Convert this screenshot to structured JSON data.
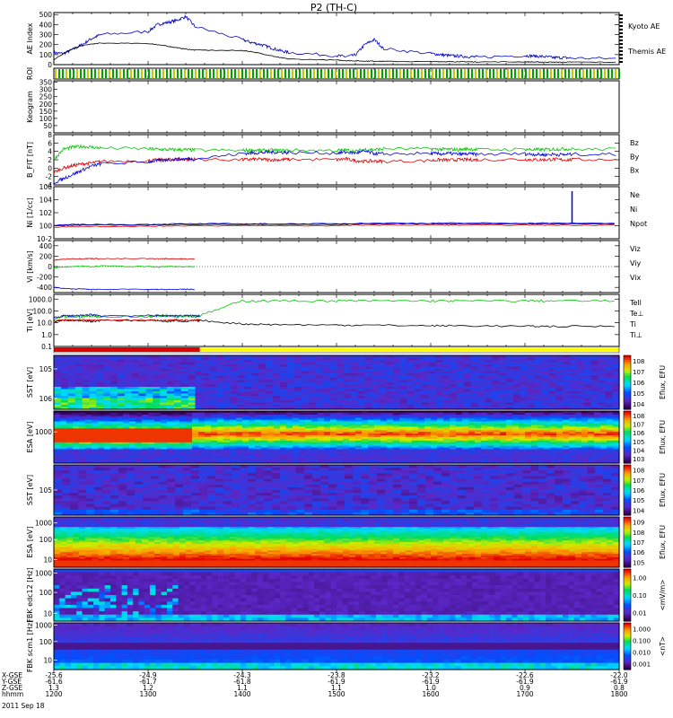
{
  "title": "P2 (TH-C)",
  "chart_data": [
    {
      "type": "line",
      "ylabel": "AE Index",
      "yticks": [
        "0",
        "100",
        "200",
        "300",
        "400",
        "500"
      ],
      "ylim": [
        0,
        520
      ],
      "x": [
        1200,
        1210,
        1220,
        1230,
        1240,
        1250,
        1300,
        1310,
        1320,
        1330,
        1340,
        1350,
        1400,
        1410,
        1420,
        1430,
        1440,
        1450,
        1500,
        1510,
        1520,
        1530,
        1540,
        1550,
        1600,
        1610,
        1620,
        1630,
        1640,
        1650,
        1700,
        1710,
        1720,
        1730,
        1740,
        1750,
        1800
      ],
      "series": [
        {
          "name": "Kyoto AE",
          "color": "#0000c8",
          "values": [
            120,
            110,
            150,
            200,
            260,
            300,
            330,
            400,
            420,
            440,
            480,
            380,
            250,
            220,
            200,
            170,
            140,
            120,
            90,
            80,
            95,
            200,
            250,
            160,
            110,
            100,
            90,
            85,
            80,
            75,
            90,
            85,
            80,
            70,
            70,
            65,
            60
          ]
        },
        {
          "name": "Themis AE",
          "color": "#000000",
          "values": [
            50,
            110,
            160,
            190,
            205,
            215,
            210,
            200,
            185,
            170,
            155,
            145,
            140,
            130,
            110,
            90,
            70,
            55,
            45,
            40,
            38,
            35,
            35,
            32,
            30,
            30,
            28,
            30,
            28,
            27,
            28,
            26,
            25,
            25,
            24,
            25,
            24
          ]
        }
      ]
    },
    {
      "type": "table",
      "ylabel": "ROI"
    },
    {
      "type": "table",
      "ylabel": "Keogram",
      "yticks": [
        "50",
        "100",
        "150",
        "200",
        "250",
        "300",
        "350"
      ]
    },
    {
      "type": "line",
      "ylabel": "B_FIT [nT]",
      "yticks": [
        "-4",
        "-2",
        "0",
        "2",
        "4",
        "6",
        "8"
      ],
      "ylim": [
        -4,
        8
      ],
      "x": [
        1200,
        1210,
        1220,
        1230,
        1240,
        1250,
        1300,
        1310,
        1320,
        1330,
        1340,
        1350,
        1400,
        1410,
        1420,
        1430,
        1440,
        1450,
        1500,
        1510,
        1520,
        1530,
        1540,
        1550,
        1600,
        1610,
        1620,
        1630,
        1640,
        1650,
        1700,
        1710,
        1720,
        1730,
        1740,
        1750,
        1800
      ],
      "series": [
        {
          "name": "Bz",
          "color": "#e00000",
          "values": [
            -1.0,
            0.0,
            0.6,
            1.0,
            1.2,
            1.6,
            1.8,
            1.9,
            2.0,
            2.1,
            2.1,
            2.1,
            2.0,
            2.1,
            2.1,
            2.0,
            2.0,
            2.1,
            2.0,
            2.2,
            1.8,
            1.6,
            1.7,
            1.6,
            1.8,
            2.0,
            1.9,
            2.0,
            2.0,
            2.0,
            2.1,
            2.0,
            2.0,
            2.1,
            2.0,
            2.0,
            2.1
          ]
        },
        {
          "name": "By",
          "color": "#00c800",
          "values": [
            2.0,
            4.5,
            5.0,
            5.2,
            5.0,
            4.8,
            4.6,
            4.5,
            4.4,
            4.4,
            4.4,
            4.3,
            4.2,
            4.3,
            4.2,
            4.3,
            4.2,
            4.3,
            4.2,
            4.3,
            4.0,
            4.5,
            4.4,
            4.6,
            4.6,
            4.5,
            4.5,
            4.4,
            4.6,
            4.4,
            4.5,
            4.4,
            4.4,
            4.5,
            4.6,
            4.5,
            4.5
          ]
        },
        {
          "name": "Bx",
          "color": "#0000e0",
          "values": [
            -3.5,
            -2.5,
            -1.5,
            -0.5,
            0.5,
            1.0,
            1.5,
            1.8,
            2.0,
            2.1,
            2.2,
            2.2,
            3.5,
            3.6,
            3.7,
            3.8,
            3.8,
            3.7,
            3.6,
            3.8,
            3.6,
            4.0,
            3.5,
            3.4,
            3.5,
            3.4,
            3.5,
            3.3,
            3.4,
            3.3,
            3.4,
            3.3,
            3.2,
            3.3,
            3.2,
            3.3,
            3.3
          ]
        }
      ]
    },
    {
      "type": "line",
      "ylabel": "Ni [1/cc]",
      "yticks": [
        "10-2",
        "100",
        "102",
        "104",
        "106"
      ],
      "ylim": [
        -2,
        6
      ],
      "x": [
        1200,
        1230,
        1300,
        1330,
        1400,
        1430,
        1500,
        1530,
        1600,
        1630,
        1700,
        1730,
        1800
      ],
      "series": [
        {
          "name": "Ne",
          "color": "#e00000",
          "values": [
            -0.2,
            -0.1,
            -0.1,
            0.0,
            0.0,
            0.0,
            0.0,
            0.1,
            0.1,
            0.1,
            0.1,
            0.1,
            0.1
          ]
        },
        {
          "name": "Ni",
          "color": "#000000",
          "values": [
            0.0,
            0.1,
            0.1,
            0.2,
            0.2,
            0.2,
            0.2,
            0.3,
            0.3,
            0.3,
            0.3,
            0.3,
            0.3
          ]
        },
        {
          "name": "Npot",
          "color": "#0000e0",
          "values": [
            0.1,
            0.2,
            0.2,
            0.3,
            0.3,
            0.3,
            0.3,
            0.4,
            0.4,
            0.4,
            0.4,
            0.4,
            0.4
          ]
        }
      ]
    },
    {
      "type": "line",
      "ylabel": "Vi [km/s]",
      "yticks": [
        "-400",
        "-200",
        "0",
        "200",
        "400"
      ],
      "ylim": [
        -500,
        500
      ],
      "x": [
        1200,
        1210,
        1220,
        1230,
        1240,
        1250,
        1300,
        1310,
        1320,
        1330,
        1340,
        1350
      ],
      "series": [
        {
          "name": "Viz",
          "color": "#e00000",
          "values": [
            120,
            140,
            150,
            150,
            155,
            150,
            150,
            150,
            150,
            150,
            145,
            145
          ]
        },
        {
          "name": "Viy",
          "color": "#00c800",
          "values": [
            -20,
            -10,
            0,
            10,
            0,
            10,
            0,
            -10,
            0,
            0,
            0,
            0
          ]
        },
        {
          "name": "Vix",
          "color": "#0000e0",
          "values": [
            -400,
            -420,
            -430,
            -430,
            -440,
            -435,
            -440,
            -440,
            -440,
            -440,
            -435,
            -440
          ]
        }
      ]
    },
    {
      "type": "line",
      "ylabel": "Ti [eV]",
      "yticks": [
        "0.1",
        "1.0",
        "10.0",
        "100.0",
        "1000.0"
      ],
      "ylim": [
        -1,
        3.4
      ],
      "x": [
        1200,
        1210,
        1220,
        1230,
        1240,
        1250,
        1300,
        1310,
        1320,
        1330,
        1340,
        1350,
        1355,
        1400,
        1430,
        1500,
        1530,
        1600,
        1630,
        1700,
        1730,
        1800
      ],
      "series": [
        {
          "name": "Tell",
          "color": "#000000",
          "values": [
            1.1,
            1.2,
            1.2,
            1.2,
            1.1,
            1.2,
            1.2,
            1.2,
            1.1,
            1.2,
            1.1,
            1.2,
            1.2,
            0.9,
            0.85,
            0.8,
            0.8,
            0.75,
            0.75,
            0.7,
            0.7,
            0.7
          ]
        },
        {
          "name": "Te⊥",
          "color": "#e00000",
          "values": [
            1.15,
            1.25,
            1.2,
            1.25,
            1.2,
            1.25,
            1.25,
            1.2,
            1.2,
            1.25,
            1.2,
            1.2,
            1.2,
            null,
            null,
            null,
            null,
            null,
            null,
            null,
            null,
            null
          ]
        },
        {
          "name": "Ti",
          "color": "#00c800",
          "values": [
            1.3,
            1.5,
            1.5,
            1.5,
            1.6,
            1.5,
            1.5,
            1.6,
            1.6,
            1.5,
            1.6,
            1.5,
            1.6,
            2.85,
            2.85,
            2.85,
            2.85,
            2.85,
            2.85,
            2.85,
            2.85,
            2.85
          ]
        },
        {
          "name": "Ti⊥",
          "color": "#0000e0",
          "values": [
            1.4,
            1.6,
            1.6,
            1.6,
            1.7,
            1.6,
            1.6,
            1.6,
            1.6,
            1.6,
            1.6,
            1.6,
            1.6,
            null,
            null,
            null,
            null,
            null,
            null,
            null,
            null,
            null
          ]
        }
      ]
    },
    {
      "type": "heatmap",
      "ylabel": "SST [eV]",
      "yticks": [
        "105",
        "106"
      ],
      "colorbar": {
        "label": "Eflux, EFU",
        "ticks": [
          "104",
          "105",
          "106",
          "107",
          "108"
        ]
      }
    },
    {
      "type": "heatmap",
      "ylabel": "ESA [eV]",
      "yticks": [
        "1000"
      ],
      "colorbar": {
        "label": "Eflux, EFU",
        "ticks": [
          "103",
          "104",
          "105",
          "106",
          "107",
          "108"
        ]
      }
    },
    {
      "type": "heatmap",
      "ylabel": "SST [eV]",
      "yticks": [
        "105"
      ],
      "colorbar": {
        "label": "Eflux, EFU",
        "ticks": [
          "104",
          "105",
          "106",
          "107",
          "108"
        ]
      }
    },
    {
      "type": "heatmap",
      "ylabel": "ESA [eV]",
      "yticks": [
        "10",
        "100",
        "1000"
      ],
      "colorbar": {
        "label": "Eflux, EFU",
        "ticks": [
          "105",
          "106",
          "107",
          "108",
          "109"
        ]
      }
    },
    {
      "type": "heatmap",
      "ylabel": "FBK edc12 [Hz]",
      "yticks": [
        "10",
        "100",
        "1000"
      ],
      "colorbar": {
        "label": "<mV/m>",
        "ticks": [
          "0.01",
          "0.10",
          "1.00"
        ]
      }
    },
    {
      "type": "heatmap",
      "ylabel": "FBK scm1 [Hz]",
      "yticks": [
        "10",
        "100",
        "1000"
      ],
      "colorbar": {
        "label": "<nT>",
        "ticks": [
          "0.001",
          "0.010",
          "0.100",
          "1.000"
        ]
      }
    }
  ],
  "footer": {
    "row_labels": [
      "X-GSE",
      "Y-GSE",
      "Z-GSE",
      "hhmm",
      "2011 Sep 18"
    ],
    "columns": [
      {
        "x": "-25.6",
        "y": "-61.6",
        "z": "1.3",
        "t": "1200"
      },
      {
        "x": "-24.9",
        "y": "-61.7",
        "z": "1.2",
        "t": "1300"
      },
      {
        "x": "-24.3",
        "y": "-61.8",
        "z": "1.1",
        "t": "1400"
      },
      {
        "x": "-23.8",
        "y": "-61.9",
        "z": "1.1",
        "t": "1500"
      },
      {
        "x": "-23.2",
        "y": "-61.9",
        "z": "1.0",
        "t": "1600"
      },
      {
        "x": "-22.6",
        "y": "-61.9",
        "z": "0.9",
        "t": "1700"
      },
      {
        "x": "-22.0",
        "y": "-61.9",
        "z": "0.8",
        "t": "1800"
      }
    ]
  },
  "colors": {
    "red": "#e00000",
    "green": "#00c800",
    "blue": "#0000e0",
    "yellow": "#ffff00"
  }
}
